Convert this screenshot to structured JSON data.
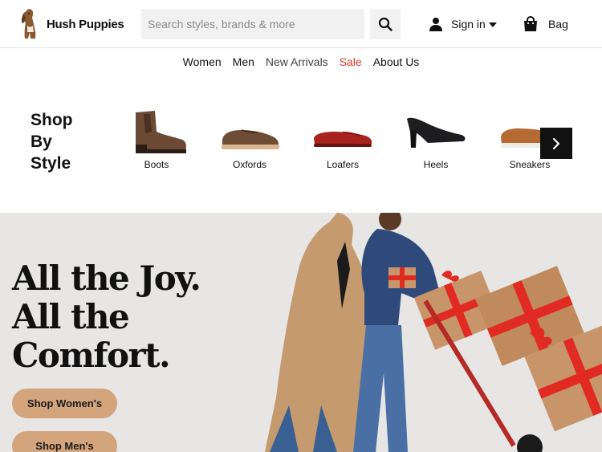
{
  "brand": {
    "name": "Hush Puppies"
  },
  "header": {
    "search": {
      "placeholder": "Search styles, brands & more",
      "value": ""
    },
    "search_icon": "search-icon",
    "signin_label": "Sign in",
    "bag_label": "Bag"
  },
  "nav": {
    "items": [
      {
        "label": "Women",
        "color": "#111111"
      },
      {
        "label": "Men",
        "color": "#111111"
      },
      {
        "label": "New Arrivals",
        "color": "#444444"
      },
      {
        "label": "Sale",
        "color": "#e8382a"
      },
      {
        "label": "About Us",
        "color": "#111111"
      }
    ]
  },
  "shop_by_style": {
    "title_lines": [
      "Shop",
      "By",
      "Style"
    ],
    "items": [
      {
        "label": "Boots"
      },
      {
        "label": "Oxfords"
      },
      {
        "label": "Loafers"
      },
      {
        "label": "Heels"
      },
      {
        "label": "Sneakers"
      }
    ],
    "next_icon": "chevron-right-icon"
  },
  "hero": {
    "headline_lines": [
      "All the Joy.",
      "All the",
      "Comfort."
    ],
    "cta_women": "Shop Women's",
    "cta_men": "Shop Men's",
    "accent_color": "#d4a47c"
  }
}
